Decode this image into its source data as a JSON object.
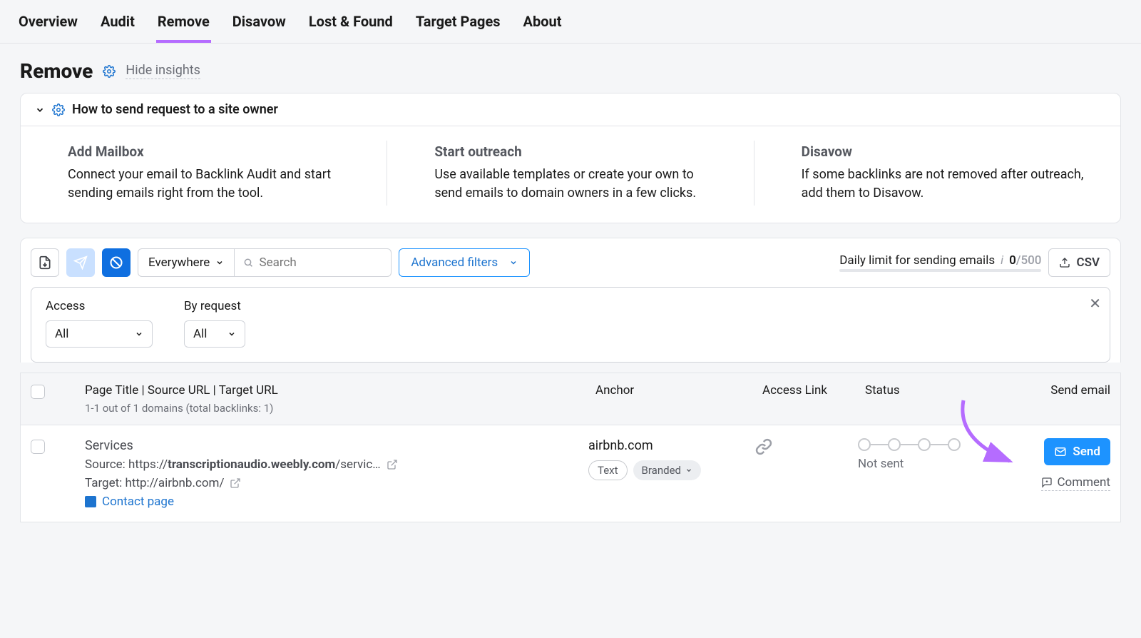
{
  "tabs": [
    "Overview",
    "Audit",
    "Remove",
    "Disavow",
    "Lost & Found",
    "Target Pages",
    "About"
  ],
  "active_tab": "Remove",
  "page_title": "Remove",
  "hide_insights": "Hide insights",
  "accordion_title": "How to send request to a site owner",
  "insights": [
    {
      "title": "Add Mailbox",
      "body": "Connect your email to Backlink Audit and start sending emails right from the tool."
    },
    {
      "title": "Start outreach",
      "body": "Use available templates or create your own to send emails to domain owners in a few clicks."
    },
    {
      "title": "Disavow",
      "body": "If some backlinks are not removed after outreach, add them to Disavow."
    }
  ],
  "toolbar": {
    "scope": "Everywhere",
    "search_placeholder": "Search",
    "advanced_filters": "Advanced filters",
    "daily_limit_label": "Daily limit for sending emails",
    "daily_limit_used": "0",
    "daily_limit_max": "/500",
    "csv": "CSV"
  },
  "filters": {
    "access_label": "Access",
    "access_value": "All",
    "byrequest_label": "By request",
    "byrequest_value": "All"
  },
  "columns": {
    "title": "Page Title | Source URL | Target URL",
    "subtitle": "1-1 out of 1 domains (total backlinks: 1)",
    "anchor": "Anchor",
    "access": "Access Link",
    "status": "Status",
    "send": "Send email"
  },
  "row": {
    "title": "Services",
    "source_label": "Source: ",
    "source_prefix": "https://",
    "source_bold": "transcriptionaudio.weebly.com",
    "source_suffix": "/servic…",
    "target_label": "Target: ",
    "target_url": "http://airbnb.com/",
    "contact": "Contact page",
    "anchor_domain": "airbnb.com",
    "pill_text": "Text",
    "pill_branded": "Branded",
    "status": "Not sent",
    "send": "Send",
    "comment": "Comment"
  }
}
